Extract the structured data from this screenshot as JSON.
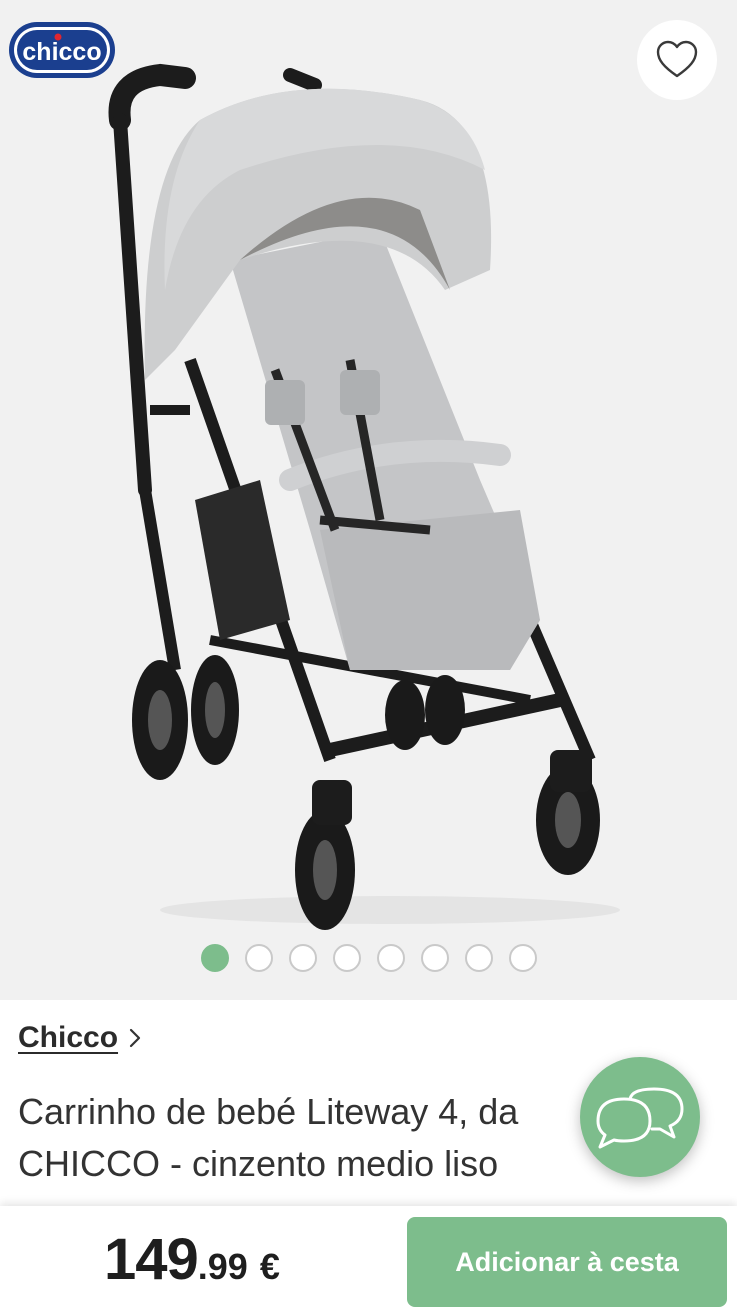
{
  "brand_logo": {
    "text": "chicco",
    "color": "#1b3f8f"
  },
  "favorite": {
    "icon": "heart-icon"
  },
  "gallery": {
    "image_alt": "Carrinho de bebé Liteway 4",
    "slide_count": 8,
    "active_slide": 1,
    "active_color": "#7dbd8c"
  },
  "product": {
    "brand": "Chicco",
    "title_line1": "Carrinho de bebé Liteway 4, da",
    "title_line2": "CHICCO - cinzento medio liso"
  },
  "chat": {
    "icon": "chat-bubbles-icon"
  },
  "price": {
    "integer": "149",
    "decimal": ".99",
    "currency": "€"
  },
  "cart_button": {
    "label": "Adicionar à cesta",
    "color": "#7dbd8c"
  }
}
